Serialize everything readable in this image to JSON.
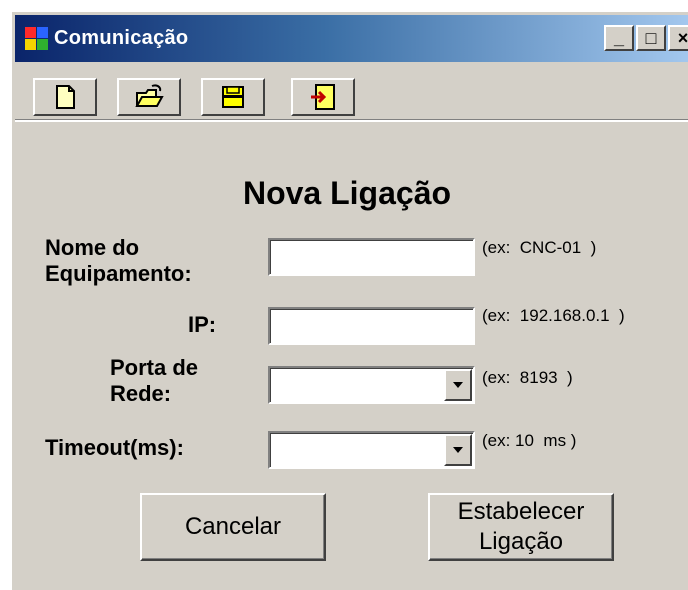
{
  "window": {
    "title": "Comunicação",
    "controls": {
      "minimize": "_",
      "maximize": "□",
      "close": "×"
    }
  },
  "toolbar": {
    "buttons": [
      {
        "icon": "new-file-icon"
      },
      {
        "icon": "open-folder-icon"
      },
      {
        "icon": "save-icon"
      },
      {
        "icon": "exit-door-icon"
      }
    ]
  },
  "form": {
    "heading": "Nova Ligação",
    "fields": [
      {
        "label": "Nome do\nEquipamento:",
        "type": "text",
        "value": "",
        "hint": "(ex:  CNC-01  )"
      },
      {
        "label": "IP:",
        "type": "text",
        "value": "",
        "hint": "(ex:  192.168.0.1  )"
      },
      {
        "label": "Porta de\nRede:",
        "type": "combo",
        "value": "",
        "hint": "(ex:  8193  )"
      },
      {
        "label": "Timeout(ms):",
        "type": "combo",
        "value": "",
        "hint": "(ex: 10  ms )"
      }
    ],
    "buttons": {
      "cancel": "Cancelar",
      "connect": "Estabelecer\nLigação"
    }
  },
  "colors": {
    "face": "#d4d0c8",
    "title_start": "#0a246a",
    "title_end": "#a6caf0"
  }
}
